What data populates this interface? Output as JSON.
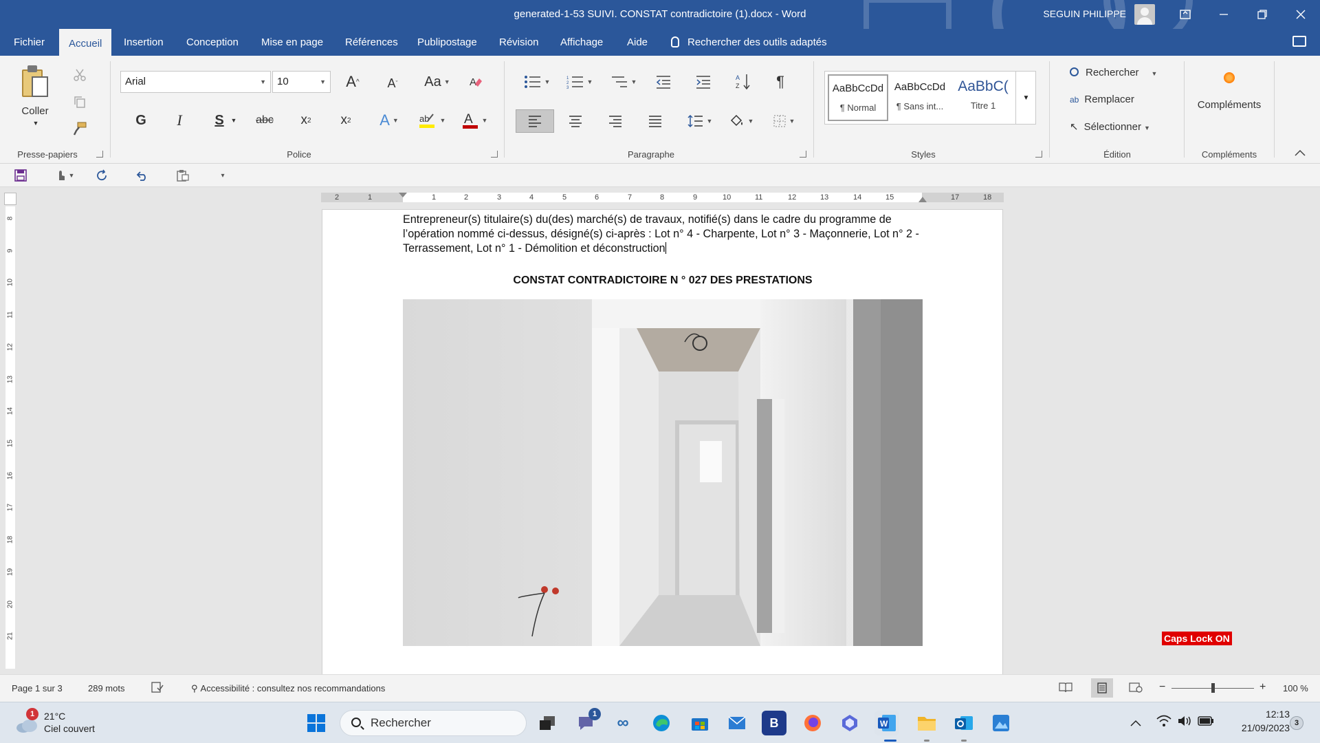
{
  "window": {
    "title": "generated-1-53  SUIVI. CONSTAT contradictoire (1).docx  -  Word",
    "user": "SEGUIN PHILIPPE"
  },
  "menu": {
    "tabs": [
      "Fichier",
      "Accueil",
      "Insertion",
      "Conception",
      "Mise en page",
      "Références",
      "Publipostage",
      "Révision",
      "Affichage",
      "Aide"
    ],
    "active": "Accueil",
    "search_tools": "Rechercher des outils adaptés"
  },
  "ribbon": {
    "clipboard": {
      "paste_label": "Coller",
      "group": "Presse-papiers"
    },
    "font": {
      "family": "Arial",
      "size": "10",
      "group": "Police",
      "bold_glyph": "G",
      "italic_glyph": "I",
      "underline_glyph": "S",
      "strike_glyph": "abc",
      "case_glyph": "Aa"
    },
    "paragraph": {
      "group": "Paragraphe"
    },
    "styles": {
      "group": "Styles",
      "items": [
        {
          "sample": "AaBbCcDd",
          "name": "¶ Normal"
        },
        {
          "sample": "AaBbCcDd",
          "name": "¶ Sans int..."
        },
        {
          "sample": "AaBbC(",
          "name": "Titre 1"
        }
      ]
    },
    "editing": {
      "group": "Édition",
      "find": "Rechercher",
      "replace": "Remplacer",
      "select": "Sélectionner"
    },
    "addins": {
      "label": "Compléments",
      "group": "Compléments"
    }
  },
  "rulers": {
    "h_left": [
      "2",
      "1"
    ],
    "h_right": [
      "1",
      "2",
      "3",
      "4",
      "5",
      "6",
      "7",
      "8",
      "9",
      "10",
      "11",
      "12",
      "13",
      "14",
      "15",
      "17",
      "18"
    ],
    "v": [
      "8",
      "9",
      "10",
      "11",
      "12",
      "13",
      "14",
      "15",
      "16",
      "17",
      "18",
      "19",
      "20",
      "21"
    ]
  },
  "document": {
    "paragraph": "Entrepreneur(s) titulaire(s) du(des) marché(s) de travaux, notifié(s) dans le cadre du programme de l’opération nommé ci-dessus, désigné(s) ci-après : Lot n° 4 - Charpente, Lot n° 3 - Maçonnerie, Lot n° 2 - Terrassement, Lot n° 1 - Démolition et déconstruction",
    "heading": "CONSTAT CONTRADICTOIRE N ° 027 DES PRESTATIONS"
  },
  "overlay": {
    "caps_lock": "Caps Lock ON"
  },
  "statusbar": {
    "page": "Page 1 sur 3",
    "words": "289 mots",
    "accessibility": "Accessibilité : consultez nos recommandations",
    "zoom": "100 %"
  },
  "taskbar": {
    "weather_temp": "21°C",
    "weather_desc": "Ciel couvert",
    "weather_badge": "1",
    "search_placeholder": "Rechercher",
    "teams_badge": "1",
    "time": "12:13",
    "date": "21/09/2023",
    "notif_count": "3"
  },
  "colors": {
    "word_blue": "#2b579a",
    "caps_red": "#e00000"
  }
}
